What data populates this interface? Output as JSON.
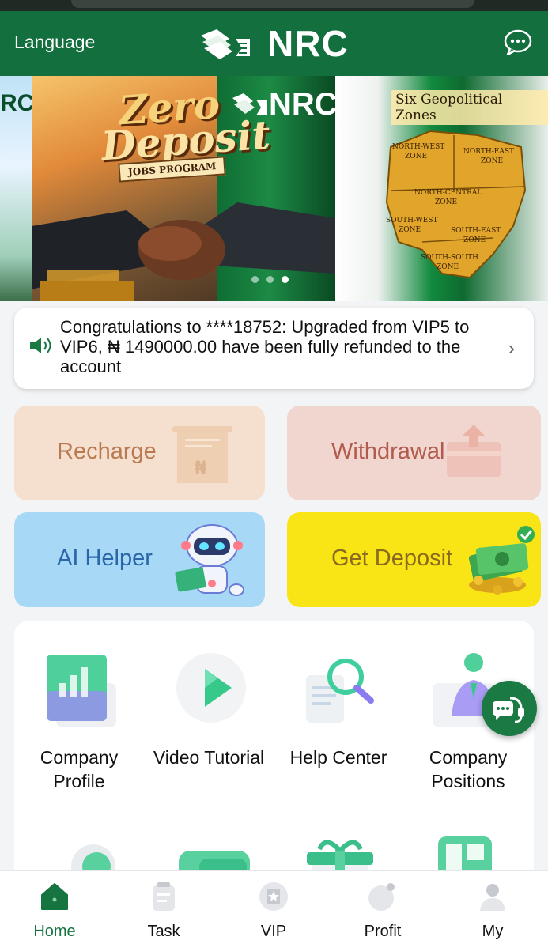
{
  "header": {
    "language_label": "Language",
    "brand": "NRC"
  },
  "banner": {
    "left_slide_text": "RC",
    "mid_slide": {
      "title_line1": "Zero",
      "title_line2": "Deposit",
      "ribbon": "JOBS PROGRAM",
      "brand": "NRC"
    },
    "right_slide": {
      "title": "Six Geopolitical Zones",
      "zones": [
        "NORTH-WEST ZONE",
        "NORTH-EAST ZONE",
        "NORTH-CENTRAL ZONE",
        "SOUTH-WEST ZONE",
        "SOUTH-EAST ZONE",
        "SOUTH-SOUTH ZONE"
      ]
    },
    "slide_count": 3,
    "active_slide": 3
  },
  "notice": {
    "text": "Congratulations to ****18752: Upgraded from VIP5 to VIP6, ₦ 1490000.00 have been fully refunded to the account"
  },
  "actions": {
    "recharge": "Recharge",
    "withdrawal": "Withdrawal",
    "ai_helper": "AI Helper",
    "get_deposit": "Get Deposit"
  },
  "menu": {
    "items": [
      {
        "label": "Company Profile",
        "icon": "chart-card-icon"
      },
      {
        "label": "Video Tutorial",
        "icon": "play-icon"
      },
      {
        "label": "Help Center",
        "icon": "magnifier-icon"
      },
      {
        "label": "Company Positions",
        "icon": "person-icon"
      }
    ]
  },
  "tabs": [
    {
      "label": "Home",
      "icon": "home-icon",
      "active": true
    },
    {
      "label": "Task",
      "icon": "clipboard-icon",
      "active": false
    },
    {
      "label": "VIP",
      "icon": "vip-badge-icon",
      "active": false
    },
    {
      "label": "Profit",
      "icon": "profit-icon",
      "active": false
    },
    {
      "label": "My",
      "icon": "user-icon",
      "active": false
    }
  ],
  "colors": {
    "brand_green": "#146f3e",
    "recharge_bg": "#f5e0d0",
    "withdrawal_bg": "#f1d6d0",
    "ai_bg": "#a7d9f7",
    "deposit_bg": "#f9e516"
  }
}
